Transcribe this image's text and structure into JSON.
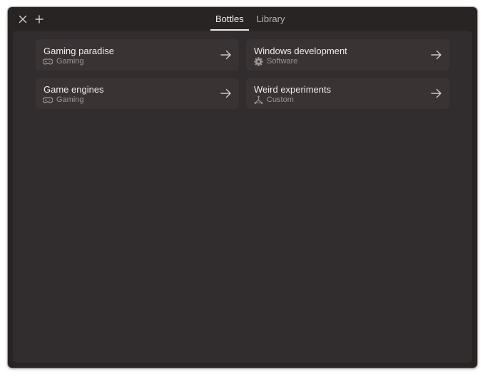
{
  "header": {
    "close_icon": "close-icon",
    "add_icon": "plus-icon",
    "tabs": [
      {
        "label": "Bottles",
        "active": true
      },
      {
        "label": "Library",
        "active": false
      }
    ]
  },
  "bottles": [
    {
      "title": "Gaming paradise",
      "category": "Gaming",
      "icon": "gamepad-icon"
    },
    {
      "title": "Windows development",
      "category": "Software",
      "icon": "gear-icon"
    },
    {
      "title": "Game engines",
      "category": "Gaming",
      "icon": "gamepad-icon"
    },
    {
      "title": "Weird experiments",
      "category": "Custom",
      "icon": "flask-icon"
    }
  ],
  "colors": {
    "window_bg": "#282424",
    "content_bg": "#312c2d",
    "card_bg": "#393334",
    "text_primary": "#f0ecec",
    "text_secondary": "#9d9596",
    "icon": "#a09898"
  }
}
